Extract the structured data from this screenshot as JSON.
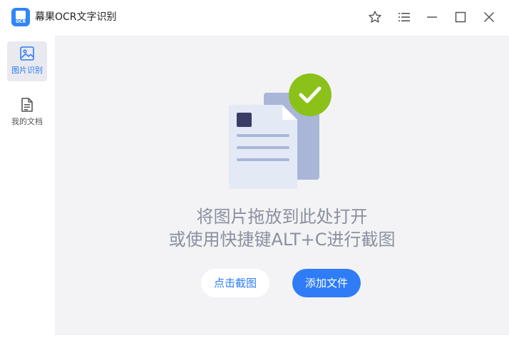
{
  "window": {
    "title": "幕果OCR文字识别",
    "logo_text": "OCR",
    "controls": [
      "star-icon",
      "menu-icon",
      "minimize-icon",
      "maximize-icon",
      "close-icon"
    ]
  },
  "sidebar": {
    "items": [
      {
        "label": "图片识别",
        "icon": "image-icon",
        "active": true
      },
      {
        "label": "我的文档",
        "icon": "document-icon",
        "active": false
      }
    ]
  },
  "main": {
    "drop_hint_line1": "将图片拖放到此处打开",
    "drop_hint_line2": "或使用快捷键ALT+C进行截图",
    "capture_button": "点击截图",
    "add_file_button": "添加文件",
    "illustration": "document-check-icon"
  },
  "colors": {
    "accent": "#2f7cf6",
    "check": "#8bc21a",
    "background": "#f3f3f6"
  }
}
